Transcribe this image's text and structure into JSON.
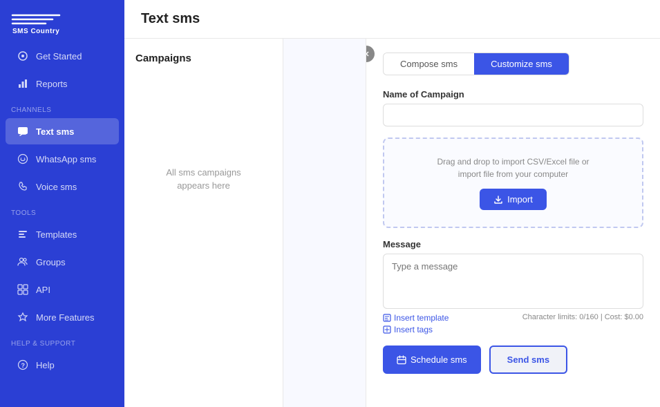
{
  "brand": {
    "name": "SMS Country"
  },
  "sidebar": {
    "top_nav": [
      {
        "id": "get-started",
        "label": "Get Started",
        "icon": "⊙"
      },
      {
        "id": "reports",
        "label": "Reports",
        "icon": "📊"
      }
    ],
    "channels_label": "Channels",
    "channels": [
      {
        "id": "text-sms",
        "label": "Text sms",
        "icon": "▣",
        "active": true
      },
      {
        "id": "whatsapp-sms",
        "label": "WhatsApp sms",
        "icon": "◎"
      },
      {
        "id": "voice-sms",
        "label": "Voice sms",
        "icon": "📞"
      }
    ],
    "tools_label": "Tools",
    "tools": [
      {
        "id": "templates",
        "label": "Templates",
        "icon": "☰"
      },
      {
        "id": "groups",
        "label": "Groups",
        "icon": "👥"
      },
      {
        "id": "api",
        "label": "API",
        "icon": "⊞"
      },
      {
        "id": "more-features",
        "label": "More Features",
        "icon": "◈"
      }
    ],
    "help_label": "Help & support",
    "help": [
      {
        "id": "help",
        "label": "Help",
        "icon": "?"
      }
    ]
  },
  "page": {
    "title": "Text sms"
  },
  "campaigns": {
    "title": "Campaigns",
    "empty_text": "All sms campaigns\nappears here"
  },
  "sms_form": {
    "tabs": [
      {
        "id": "compose",
        "label": "Compose sms",
        "active": false
      },
      {
        "id": "customize",
        "label": "Customize sms",
        "active": true
      }
    ],
    "name_of_campaign_label": "Name of Campaign",
    "name_of_campaign_placeholder": "",
    "upload_hint": "Drag and drop to import CSV/Excel file or\nimport file from your computer",
    "import_button": "Import",
    "message_label": "Message",
    "message_placeholder": "Type a message",
    "insert_template_link": "Insert template",
    "insert_tags_link": "Insert tags",
    "char_limit_text": "Character limits: 0/160 | Cost: $0.00",
    "schedule_button": "Schedule sms",
    "send_button": "Send sms"
  }
}
